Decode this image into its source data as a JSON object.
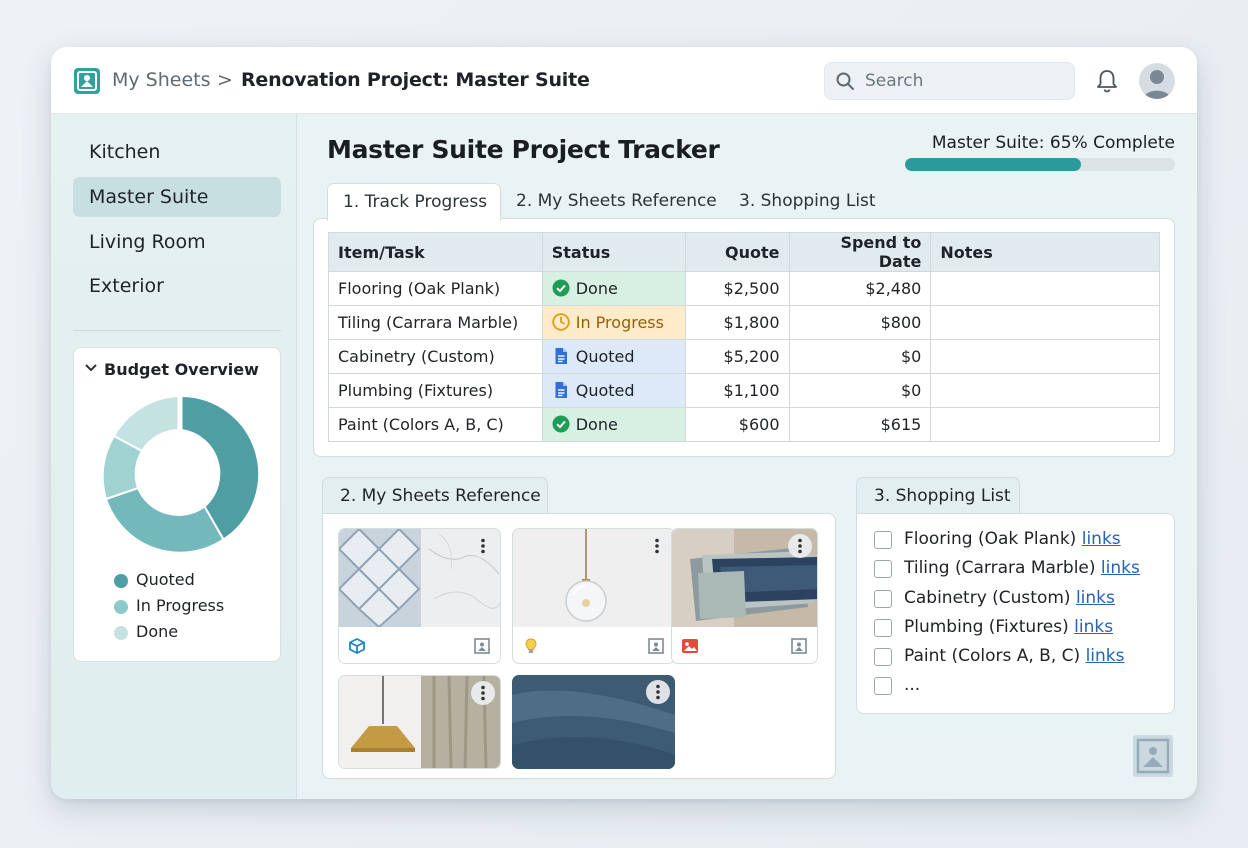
{
  "header": {
    "breadcrumb_root": "My Sheets",
    "breadcrumb_separator": ">",
    "breadcrumb_current": "Renovation Project: Master Suite",
    "search_placeholder": "Search",
    "icons": [
      "app-logo-icon",
      "search-icon",
      "bell-icon",
      "avatar"
    ]
  },
  "sidebar": {
    "items": [
      {
        "label": "Kitchen",
        "active": false
      },
      {
        "label": "Master Suite",
        "active": true
      },
      {
        "label": "Living Room",
        "active": false
      },
      {
        "label": "Exterior",
        "active": false
      }
    ],
    "budget": {
      "title": "Budget Overview",
      "legend": [
        {
          "label": "Quoted",
          "color": "#4f9ea3"
        },
        {
          "label": "In Progress",
          "color": "#8ccaca"
        },
        {
          "label": "Done",
          "color": "#c4e2e2"
        }
      ]
    }
  },
  "main": {
    "title": "Master Suite Project Tracker",
    "progress": {
      "label": "Master Suite: 65% Complete",
      "percent": 65,
      "color": "#2a9a9b"
    },
    "tabs": [
      {
        "label": "1. Track Progress",
        "active": true
      },
      {
        "label": "2. My Sheets Reference",
        "active": false
      },
      {
        "label": "3. Shopping List",
        "active": false
      }
    ],
    "table": {
      "columns": [
        "Item/Task",
        "Status",
        "Quote",
        "Spend to Date",
        "Notes"
      ],
      "rows": [
        {
          "item": "Flooring (Oak Plank)",
          "status": "Done",
          "quote": "$2,500",
          "spend": "$2,480",
          "notes": ""
        },
        {
          "item": "Tiling (Carrara Marble)",
          "status": "In Progress",
          "quote": "$1,800",
          "spend": "$800",
          "notes": ""
        },
        {
          "item": "Cabinetry (Custom)",
          "status": "Quoted",
          "quote": "$5,200",
          "spend": "$0",
          "notes": ""
        },
        {
          "item": "Plumbing (Fixtures)",
          "status": "Quoted",
          "quote": "$1,100",
          "spend": "$0",
          "notes": ""
        },
        {
          "item": "Paint (Colors A, B, C)",
          "status": "Done",
          "quote": "$600",
          "spend": "$615",
          "notes": ""
        }
      ]
    },
    "reference": {
      "tab_label": "2. My Sheets Reference",
      "thumbnails": [
        {
          "image": "tile-and-marble",
          "icon": "cube-icon"
        },
        {
          "image": "glass-pendant-light",
          "icon": "lightbulb-icon"
        },
        {
          "image": "fabric-swatches",
          "icon": "image-icon"
        },
        {
          "image": "brass-pendant-and-curtain",
          "icon": ""
        },
        {
          "image": "blue-fabric",
          "icon": ""
        }
      ]
    },
    "shopping": {
      "tab_label": "3. Shopping List",
      "link_text": "links",
      "items": [
        "Flooring (Oak Plank)",
        "Tiling (Carrara Marble)",
        "Cabinetry (Custom)",
        "Plumbing (Fixtures)",
        "Paint (Colors A, B, C)",
        "..."
      ]
    }
  }
}
